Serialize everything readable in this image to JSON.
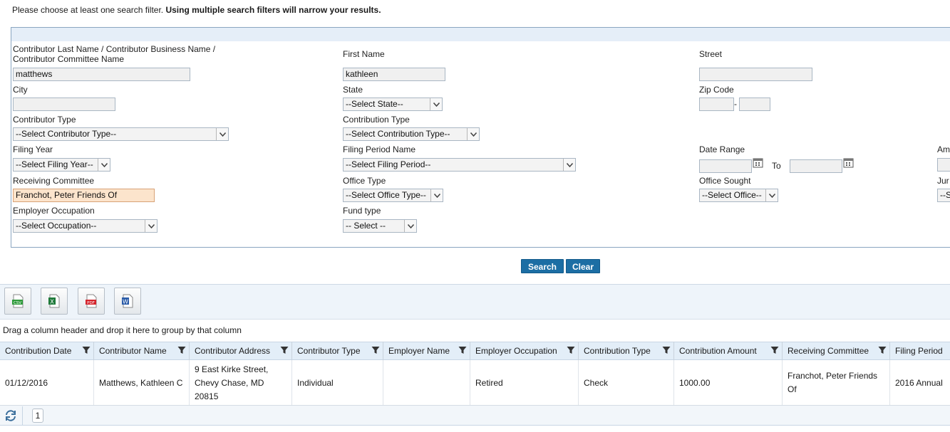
{
  "intro": {
    "normal": "Please choose at least one search filter. ",
    "bold": "Using multiple search filters will narrow your results."
  },
  "filters": {
    "contributor_name_label": "Contributor Last Name / Contributor Business Name / Contributor Committee Name",
    "contributor_name_value": "matthews",
    "first_name_label": "First Name",
    "first_name_value": "kathleen",
    "street_label": "Street",
    "street_value": "",
    "city_label": "City",
    "city_value": "",
    "state_label": "State",
    "state_value": "--Select State--",
    "zip_label": "Zip Code",
    "zip_dash": "-",
    "contributor_type_label": "Contributor Type",
    "contributor_type_value": "--Select Contributor Type--",
    "contribution_type_label": "Contribution Type",
    "contribution_type_value": "--Select Contribution Type--",
    "filing_year_label": "Filing Year",
    "filing_year_value": "--Select Filing Year--",
    "filing_period_label": "Filing Period Name",
    "filing_period_value": "--Select Filing Period--",
    "date_range_label": "Date Range",
    "date_to_label": "To",
    "amount_label_partial": "Am",
    "receiving_committee_label": "Receiving Committee",
    "receiving_committee_value": "Franchot, Peter Friends Of",
    "office_type_label": "Office Type",
    "office_type_value": "--Select Office Type--",
    "office_sought_label": "Office Sought",
    "office_sought_value": "--Select Office--",
    "jurisdiction_label_partial": "Jur",
    "jurisdiction_value_partial": "--S",
    "employer_occupation_label": "Employer Occupation",
    "employer_occupation_value": "--Select Occupation--",
    "fund_type_label": "Fund type",
    "fund_type_value": "-- Select --"
  },
  "buttons": {
    "search": "Search",
    "clear": "Clear"
  },
  "export_tools": [
    {
      "icon": "csv-export-icon",
      "text": "CSV",
      "color": "#2e9a3a"
    },
    {
      "icon": "excel-export-icon",
      "text": "X",
      "color": "#1f7a3a"
    },
    {
      "icon": "pdf-export-icon",
      "text": "PDF",
      "color": "#d4232b"
    },
    {
      "icon": "word-export-icon",
      "text": "W",
      "color": "#2a5ba8"
    }
  ],
  "group_hint": "Drag a column header and drop it here to group by that column",
  "grid": {
    "columns": [
      "Contribution Date",
      "Contributor Name",
      "Contributor Address",
      "Contributor Type",
      "Employer Name",
      "Employer Occupation",
      "Contribution Type",
      "Contribution Amount",
      "Receiving Committee",
      "Filing Period"
    ],
    "row": [
      "01/12/2016",
      "Matthews, Kathleen C",
      "9 East Kirke Street, Chevy Chase, MD 20815",
      "Individual",
      "",
      "Retired",
      "Check",
      "1000.00",
      "Franchot, Peter Friends Of",
      "2016 Annual"
    ]
  },
  "pager": {
    "current_page": "1"
  },
  "colors": {
    "accent": "#1c6ea4",
    "header_bg": "#e3eef8",
    "highlight": "#fce4cc"
  }
}
